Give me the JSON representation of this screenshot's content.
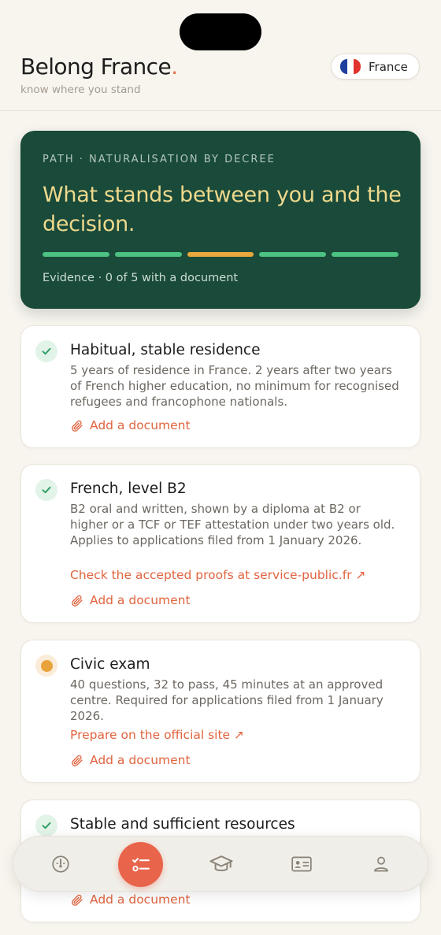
{
  "app": {
    "brand": "Belong France",
    "brand_dot": ".",
    "tagline": "know where you stand"
  },
  "country": {
    "label": "France",
    "flag_colors": [
      "#1f3f9f",
      "#ffffff",
      "#e1332f"
    ]
  },
  "hero": {
    "eyebrow": "PATH · NATURALISATION BY DECREE",
    "title": "What stands between you and the decision.",
    "progress": [
      "#4bc282",
      "#4bc282",
      "#e9a83c",
      "#4bc282",
      "#4bc282"
    ],
    "evidence": "Evidence · 0 of 5 with a document"
  },
  "cards": [
    {
      "title": "Habitual, stable residence",
      "status": "done",
      "description": "5 years of residence in France. 2 years after two years of French higher education, no minimum for recognised refugees and francophone nationals.",
      "link": "",
      "add_document": "Add a document"
    },
    {
      "title": "French, level B2",
      "status": "done",
      "description": "B2 oral and written, shown by a diploma at B2 or higher or a TCF or TEF attestation under two years old. Applies to applications filed from 1 January 2026.",
      "link": "Check the accepted proofs at service-public.fr ↗",
      "add_document": "Add a document"
    },
    {
      "title": "Civic exam",
      "status": "pending",
      "description": "40 questions, 32 to pass, 45 minutes at an approved centre. Required for applications filed from 1 January 2026.",
      "link": "Prepare on the official site ↗",
      "add_document": "Add a document"
    },
    {
      "title": "Stable and sufficient resources",
      "status": "done",
      "description": "",
      "link": "",
      "add_document": "Add a document"
    }
  ],
  "tabbar": {
    "active_tab": "checklist",
    "tabs": [
      "dashboard-icon",
      "checklist-icon",
      "graduation-cap-icon",
      "id-card-icon",
      "profile-icon"
    ]
  },
  "colors": {
    "accent": "#e8644b",
    "hero_bg": "#194a3a",
    "hero_title": "#eed98c",
    "done": "#2f9e63",
    "pending": "#e8a33a"
  }
}
